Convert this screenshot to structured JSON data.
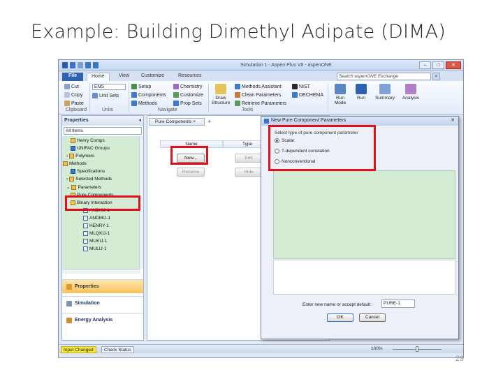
{
  "slide": {
    "title": "Example: Building Dimethyl Adipate (DIMA)",
    "page_number": "29"
  },
  "window": {
    "title": "Simulation 1 - Aspen Plus V8 - aspenONE",
    "controls": [
      "–",
      "□",
      "✕"
    ]
  },
  "ribbon_tabs": [
    "File",
    "Home",
    "View",
    "Customize",
    "Resources"
  ],
  "search": {
    "placeholder": "Search aspenONE Exchange",
    "icon": "search-icon"
  },
  "ribbon": {
    "clipboard": {
      "cut": "Cut",
      "copy": "Copy",
      "paste": "Paste",
      "label": "Clipboard"
    },
    "units": {
      "set": "ENG",
      "unit_sets": "Unit Sets",
      "label": "Units"
    },
    "navigate": {
      "setup": "Setup",
      "components": "Components",
      "methods": "Methods",
      "chemistry": "Chemistry",
      "customize": "Customize",
      "prop_sets": "Prop Sets",
      "label": "Navigate"
    },
    "tools": {
      "draw_structure": "Draw Structure",
      "methods_assistant": "Methods Assistant",
      "clean_parameters": "Clean Parameters",
      "retrieve_parameters": "Retrieve Parameters",
      "nist": "NIST",
      "dechema": "DECHEMA",
      "label": "Tools"
    },
    "run": {
      "run_mode": "Run Mode",
      "run": "Run",
      "summary": "Summary",
      "analysis": "Analysis"
    }
  },
  "properties_pane": {
    "header": "Properties",
    "filter": "All Items",
    "tree": [
      {
        "label": "Henry Comps",
        "icon": "folder-icon"
      },
      {
        "label": "UNIFAC Groups",
        "icon": "check-icon"
      },
      {
        "label": "Polymers",
        "icon": "folder-icon"
      },
      {
        "label": "Methods",
        "icon": "folder-icon"
      },
      {
        "label": "Specifications",
        "icon": "check-icon"
      },
      {
        "label": "Selected Methods",
        "icon": "folder-icon"
      },
      {
        "label": "Parameters",
        "icon": "folder-icon"
      },
      {
        "label": "Pure Components",
        "icon": "folder-icon"
      },
      {
        "label": "Binary Interaction",
        "icon": "folder-icon"
      },
      {
        "label": "ANDKIJ-1",
        "icon": "doc-icon"
      },
      {
        "label": "ANDMIJ-1",
        "icon": "doc-icon"
      },
      {
        "label": "HENRY-1",
        "icon": "doc-icon"
      },
      {
        "label": "MLQKIJ-1",
        "icon": "doc-icon"
      },
      {
        "label": "MUKIJ-1",
        "icon": "doc-icon"
      },
      {
        "label": "MULIJ-1",
        "icon": "doc-icon"
      }
    ],
    "nav_buttons": [
      "Properties",
      "Simulation",
      "Energy Analysis"
    ]
  },
  "center": {
    "doc_tab": "Pure Components",
    "columns": [
      "Name",
      "Type"
    ],
    "buttons": {
      "new": "New...",
      "edit": "Edit",
      "rename": "Rename",
      "hide": "Hide"
    }
  },
  "dialog": {
    "title": "New Pure Component Parameters",
    "group_label": "Select type of pure component parameter",
    "options": [
      "Scalar",
      "T-dependent correlation",
      "Nonconventional"
    ],
    "selected": "Scalar",
    "name_prompt": "Enter new name or accept default :",
    "name_value": "PURE-1",
    "ok": "OK",
    "cancel": "Cancel"
  },
  "status": {
    "input_changed": "Input Changed",
    "check_status": "Check Status",
    "zoom": "100%"
  },
  "colors": {
    "highlight": "#e0101a",
    "tree_bg": "#d4ebd4",
    "status_yellow": "#f6e93a"
  }
}
